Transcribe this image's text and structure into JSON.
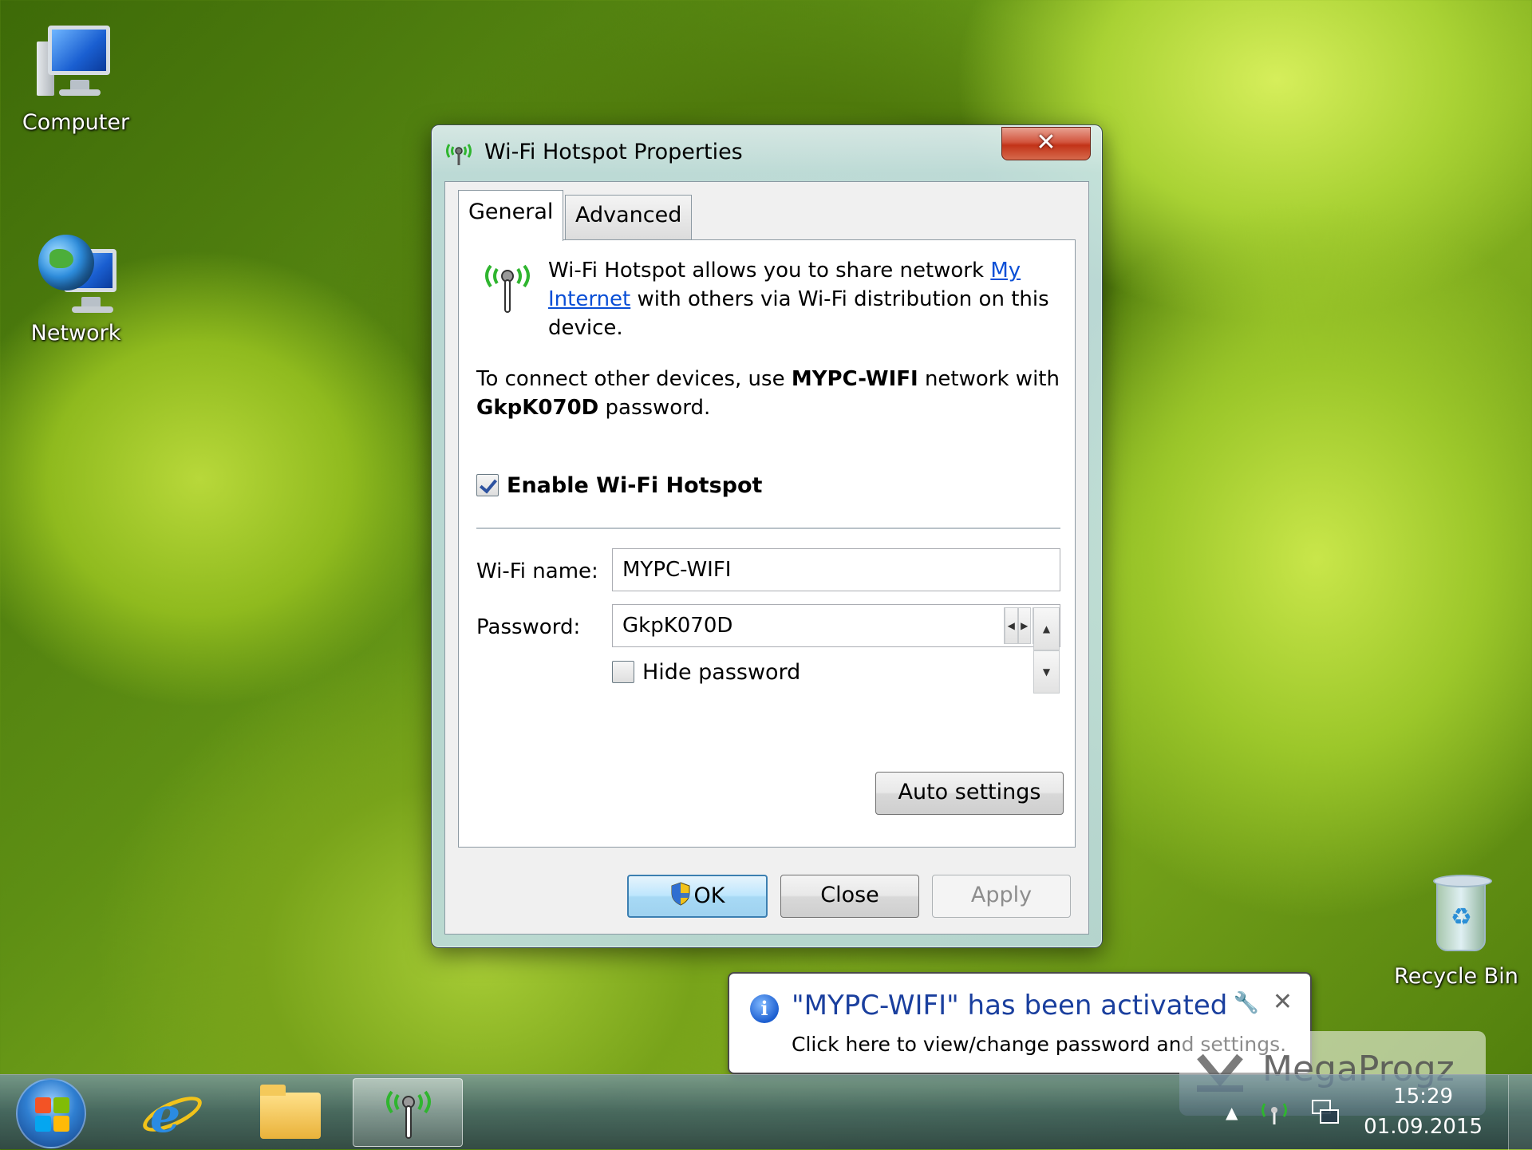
{
  "desktop": {
    "icons": [
      {
        "label": "Computer"
      },
      {
        "label": "Network"
      },
      {
        "label": "Recycle Bin"
      }
    ]
  },
  "dialog": {
    "title": "Wi-Fi Hotspot Properties",
    "close_glyph": "✕",
    "tabs": [
      {
        "label": "General",
        "active": true
      },
      {
        "label": "Advanced",
        "active": false
      }
    ],
    "intro_part1": "Wi-Fi Hotspot allows you to share network ",
    "intro_link": "My Internet",
    "intro_part2": " with others via Wi-Fi distribution on this device.",
    "connect_part1": "To connect other devices, use ",
    "connect_network": "MYPC-WIFI",
    "connect_part2": " network with",
    "connect_password": "GkpK070D",
    "connect_part3": " password.",
    "enable_label": "Enable Wi-Fi Hotspot",
    "enable_checked": true,
    "wifi_name_label": "Wi-Fi name:",
    "wifi_name_value": "MYPC-WIFI",
    "password_label": "Password:",
    "password_value": "GkpK070D",
    "hide_password_label": "Hide password",
    "hide_password_checked": false,
    "auto_settings_label": "Auto settings",
    "ok_label": "OK",
    "close_label": "Close",
    "apply_label": "Apply"
  },
  "notification": {
    "title": "\"MYPC-WIFI\" has been activated",
    "text": "Click here to view/change password and settings."
  },
  "watermark": {
    "text": "MegaProgz"
  },
  "taskbar": {
    "time": "15:29",
    "date": "01.09.2015"
  },
  "colors": {
    "link": "#0a4fd6",
    "hotspot_green": "#2fb52f",
    "notification_title": "#1a3f9e"
  }
}
